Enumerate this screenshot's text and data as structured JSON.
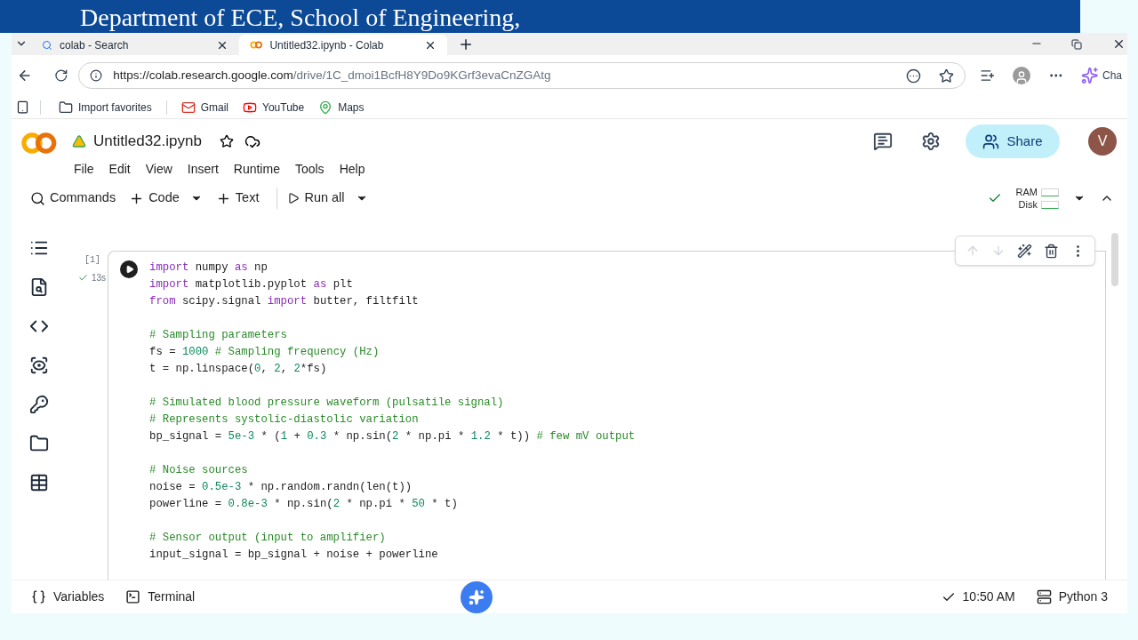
{
  "banner": {
    "title": "Department of ECE, School of  Engineering,"
  },
  "browser": {
    "tabs": [
      {
        "title": "colab - Search",
        "selected": false
      },
      {
        "title": "Untitled32.ipynb - Colab",
        "selected": true
      }
    ],
    "url": {
      "host": "https://colab.research.google.com",
      "path": "/drive/1C_dmoi1BcfH8Y9Do9KGrf3evaCnZGAtg"
    },
    "chat_label": "Cha",
    "bookmarks": [
      "Import favorites",
      "Gmail",
      "YouTube",
      "Maps"
    ]
  },
  "notebook": {
    "title": "Untitled32.ipynb",
    "menu": [
      "File",
      "Edit",
      "View",
      "Insert",
      "Runtime",
      "Tools",
      "Help"
    ],
    "toolbar": [
      {
        "label": "Commands",
        "caret": false
      },
      {
        "label": "Code",
        "caret": true
      },
      {
        "label": "Text",
        "caret": false
      },
      {
        "label": "Run all",
        "caret": true
      }
    ],
    "share": "Share",
    "avatar": "V",
    "resources": [
      "RAM",
      "Disk"
    ],
    "cell": {
      "count": "[1]",
      "time": "13s",
      "blocks": [
        [
          [
            {
              "kind": "keyword",
              "text": "import"
            },
            {
              "kind": "text",
              "text": " numpy "
            },
            {
              "kind": "keyword",
              "text": "as"
            },
            {
              "kind": "text",
              "text": " np"
            }
          ],
          [
            {
              "kind": "keyword",
              "text": "import"
            },
            {
              "kind": "text",
              "text": " matplotlib.pyplot "
            },
            {
              "kind": "keyword",
              "text": "as"
            },
            {
              "kind": "text",
              "text": " plt"
            }
          ],
          [
            {
              "kind": "keyword",
              "text": "from"
            },
            {
              "kind": "text",
              "text": " scipy.signal "
            },
            {
              "kind": "keyword",
              "text": "import"
            },
            {
              "kind": "text",
              "text": " butter, filtfilt"
            }
          ]
        ],
        [
          [
            {
              "kind": "comment",
              "text": "# Sampling parameters"
            }
          ],
          [
            {
              "kind": "text",
              "text": "fs = "
            },
            {
              "kind": "number",
              "text": "1000"
            },
            {
              "kind": "comment",
              "text": " # Sampling frequency (Hz)"
            }
          ],
          [
            {
              "kind": "text",
              "text": "t = np.linspace("
            },
            {
              "kind": "number",
              "text": "0"
            },
            {
              "kind": "text",
              "text": ", "
            },
            {
              "kind": "number",
              "text": "2"
            },
            {
              "kind": "text",
              "text": ", "
            },
            {
              "kind": "number",
              "text": "2"
            },
            {
              "kind": "text",
              "text": "*fs)"
            }
          ]
        ],
        [
          [
            {
              "kind": "comment",
              "text": "# Simulated blood pressure waveform (pulsatile signal)"
            }
          ],
          [
            {
              "kind": "comment",
              "text": "# Represents systolic-diastolic variation"
            }
          ],
          [
            {
              "kind": "text",
              "text": "bp_signal = "
            },
            {
              "kind": "number",
              "text": "5e-3"
            },
            {
              "kind": "text",
              "text": " * ("
            },
            {
              "kind": "number",
              "text": "1"
            },
            {
              "kind": "text",
              "text": " + "
            },
            {
              "kind": "number",
              "text": "0.3"
            },
            {
              "kind": "text",
              "text": " * np.sin("
            },
            {
              "kind": "number",
              "text": "2"
            },
            {
              "kind": "text",
              "text": " * np.pi * "
            },
            {
              "kind": "number",
              "text": "1.2"
            },
            {
              "kind": "text",
              "text": " * t)) "
            },
            {
              "kind": "comment",
              "text": "# few mV output"
            }
          ]
        ],
        [
          [
            {
              "kind": "comment",
              "text": "# Noise sources"
            }
          ],
          [
            {
              "kind": "text",
              "text": "noise = "
            },
            {
              "kind": "number",
              "text": "0.5e-3"
            },
            {
              "kind": "text",
              "text": " * np.random.randn(len(t))"
            }
          ],
          [
            {
              "kind": "text",
              "text": "powerline = "
            },
            {
              "kind": "number",
              "text": "0.8e-3"
            },
            {
              "kind": "text",
              "text": " * np.sin("
            },
            {
              "kind": "number",
              "text": "2"
            },
            {
              "kind": "text",
              "text": " * np.pi * "
            },
            {
              "kind": "number",
              "text": "50"
            },
            {
              "kind": "text",
              "text": " * t)"
            }
          ]
        ],
        [
          [
            {
              "kind": "comment",
              "text": "# Sensor output (input to amplifier)"
            }
          ],
          [
            {
              "kind": "text",
              "text": "input_signal = bp_signal + noise + powerline"
            }
          ]
        ]
      ]
    }
  },
  "footer": {
    "left": [
      "Variables",
      "Terminal"
    ],
    "time": "10:50 AM",
    "runtime": "Python 3"
  }
}
